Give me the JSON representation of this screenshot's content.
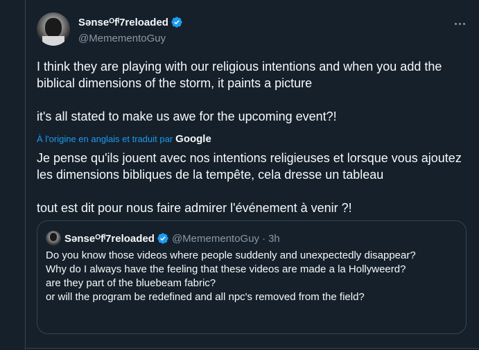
{
  "tweet": {
    "author": {
      "display_name": "Sənseᴼfˡ7reloaded",
      "handle": "@MemementoGuy",
      "verified": true
    },
    "more_menu_icon": "more-horizontal-icon",
    "text": [
      "I think they are playing with our religious intentions and when you add the biblical dimensions of the storm, it paints a picture",
      "it's all stated to make us awe for the upcoming event?!"
    ],
    "translation_note": "À l'origine en anglais et traduit par",
    "translation_provider": "Google",
    "translated_text": [
      "Je pense qu'ils jouent avec nos intentions religieuses et lorsque vous ajoutez les dimensions bibliques de la tempête, cela dresse un tableau",
      "tout est dit pour nous faire admirer l'événement à venir ?!"
    ]
  },
  "quoted_tweet": {
    "display_name": "Sənseᴼfˡ7reloaded",
    "handle": "@MemementoGuy",
    "separator": "·",
    "time": "3h",
    "lines": [
      "Do you know those videos where people suddenly and unexpectedly disappear?",
      "Why do I always have the feeling that these videos are made a la Hollyweerd?",
      "are they part of the bluebeam fabric?",
      "or will the program be redefined and all npc's removed from the field?"
    ]
  },
  "colors": {
    "background": "#15202b",
    "text": "#f7f9f9",
    "secondary": "#8b98a5",
    "accent": "#1d9bf0",
    "border": "#38444d"
  }
}
